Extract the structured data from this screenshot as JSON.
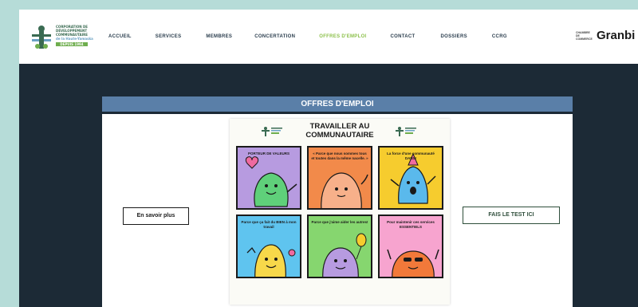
{
  "logo": {
    "lines": [
      "CORPORATION DE",
      "DÉVELOPPEMENT",
      "COMMUNAUTAIRE"
    ],
    "sub": "de la Haute-Yamaska",
    "tag": "DEPUIS 1994"
  },
  "nav": [
    {
      "label": "ACCUEIL",
      "active": false
    },
    {
      "label": "SERVICES",
      "active": false
    },
    {
      "label": "MEMBRES",
      "active": false
    },
    {
      "label": "CONCERTATION",
      "active": false
    },
    {
      "label": "OFFRES D'EMPLOI",
      "active": true
    },
    {
      "label": "CONTACT",
      "active": false
    },
    {
      "label": "DOSSIERS",
      "active": false
    },
    {
      "label": "CCRG",
      "active": false
    }
  ],
  "partner": {
    "small": "CHAMBRE DE COMMERCE",
    "word": "Granbi"
  },
  "section": {
    "title": "OFFRES D'EMPLOI"
  },
  "buttons": {
    "learn_more": "En savoir plus",
    "take_test": "FAIS LE TEST ICI"
  },
  "poster": {
    "title": "TRAVAILLER AU COMMUNAUTAIRE",
    "cards": [
      {
        "text": "PORTEUR DE VALEURS",
        "color": "#b79be0"
      },
      {
        "text": "« Parce que nous sommes tous et toutes dans la même nacelle. »",
        "color": "#f28a4a"
      },
      {
        "text": "La force d'une communauté DANS!",
        "color": "#f6cc2e"
      },
      {
        "text": "Parce que ça fait du BIEN à mon travail",
        "color": "#5fc4ef"
      },
      {
        "text": "Parce que j'aime aider les autres!",
        "color": "#86d66f"
      },
      {
        "text": "Pour maintenir ces services ESSENTIELS",
        "color": "#f7a4cf"
      }
    ]
  },
  "colors": {
    "page_bg": "#b6dcd8",
    "content_bg": "#1c2a36",
    "banner": "#5a7fa8",
    "nav_active": "#8cc04a"
  }
}
